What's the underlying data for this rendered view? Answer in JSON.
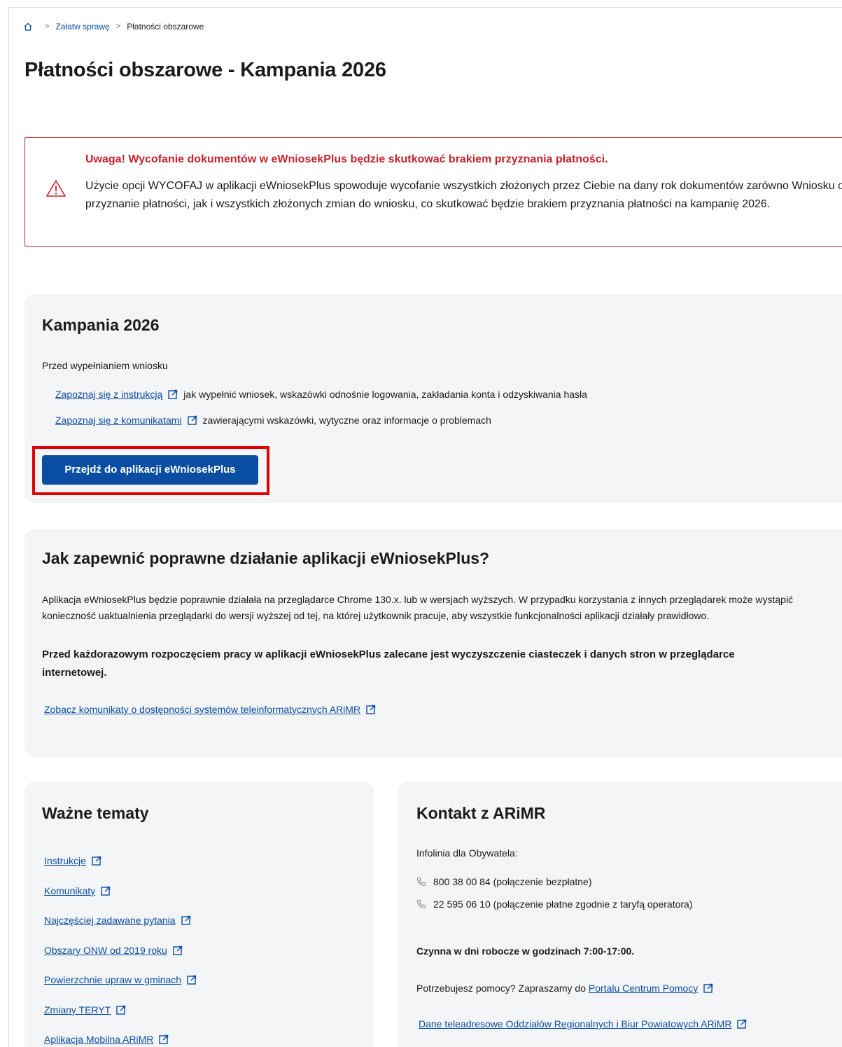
{
  "breadcrumb": {
    "home_icon": "home-icon",
    "items": [
      "Załatw sprawę",
      "Płatności obszarowe"
    ]
  },
  "page_title": "Płatności obszarowe - Kampania 2026",
  "alert": {
    "icon": "warning-triangle-icon",
    "title": "Uwaga! Wycofanie dokumentów w eWniosekPlus będzie skutkować brakiem przyznania płatności.",
    "body": "Użycie opcji WYCOFAJ w aplikacji eWniosekPlus spowoduje wycofanie wszystkich złożonych przez Ciebie na dany rok dokumentów zarówno Wniosku o przyznanie płatności, jak i wszystkich złożonych zmian do wniosku, co skutkować będzie brakiem przyznania płatności na kampanię 2026."
  },
  "kampania": {
    "title": "Kampania 2026",
    "intro": "Przed wypełnianiem wniosku",
    "link1": "Zapoznaj się z instrukcją",
    "link1_rest": "jak wypełnić wniosek, wskazówki odnośnie logowania, zakładania konta i odzyskiwania hasła",
    "link2": "Zapoznaj się z komunikatami",
    "link2_rest": "zawierającymi wskazówki, wytyczne oraz informacje o problemach",
    "button": "Przejdź do aplikacji eWniosekPlus"
  },
  "jak": {
    "title": "Jak zapewnić poprawne działanie aplikacji eWniosekPlus?",
    "p1": "Aplikacja eWniosekPlus będzie poprawnie działała na przeglądarce Chrome 130.x. lub w wersjach wyższych. W przypadku korzystania z innych przeglądarek może wystąpić konieczność uaktualnienia przeglądarki do wersji wyższej od tej, na której użytkownik pracuje, aby wszystkie funkcjonalności aplikacji działały prawidłowo.",
    "p2_line1": "Przed każdorazowym rozpoczęciem pracy w aplikacji eWniosekPlus zalecane jest wyczyszczenie ciasteczek i danych stron w przeglądarce",
    "p2_line2": "internetowej.",
    "link": "Zobacz komunikaty o dostępności systemów teleinformatycznych ARiMR"
  },
  "wazne": {
    "title": "Ważne tematy",
    "items": [
      "Instrukcje",
      "Komunikaty",
      "Najczęściej zadawane pytania",
      "Obszary ONW od 2019 roku",
      "Powierzchnie upraw w gminach",
      "Zmiany TERYT",
      "Aplikacja Mobilna ARiMR"
    ]
  },
  "kontakt": {
    "title": "Kontakt z ARiMR",
    "infolinia": "Infolinia dla Obywatela:",
    "phone1": "800 38 00 84 (połączenie bezpłatne)",
    "phone2": "22 595 06 10 (połączenie płatne zgodnie z taryfą operatora)",
    "hours": "Czynna w dni robocze w godzinach 7:00-17:00.",
    "help_text": "Potrzebujesz pomocy? Zapraszamy do",
    "help_link": "Portalu Centrum Pomocy",
    "dane_link": "Dane teleadresowe Oddziałów Regionalnych i Biur Powiatowych ARiMR"
  },
  "colors": {
    "primary": "#0a4ea3",
    "alert_red": "#c5242b",
    "card_bg": "#f4f5f7",
    "highlight": "#e00000"
  }
}
